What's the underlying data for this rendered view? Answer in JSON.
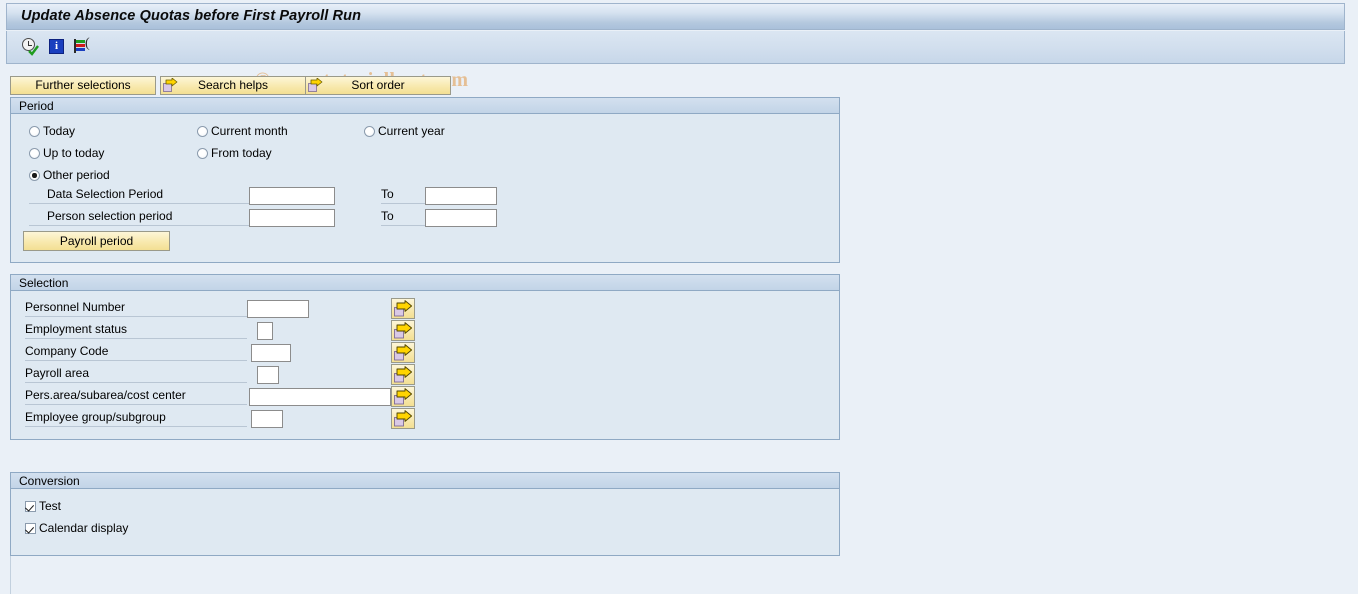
{
  "window": {
    "title": "Update Absence Quotas before First Payroll Run"
  },
  "watermark": "© www.tutorialkart.com",
  "toolbar": {
    "icons": [
      {
        "name": "execute-clock-icon",
        "label": "Execute"
      },
      {
        "name": "information-icon",
        "label": "Information"
      },
      {
        "name": "variants-icon",
        "label": "Variants"
      }
    ]
  },
  "button_row": [
    {
      "label": "Further selections",
      "icon": ""
    },
    {
      "label": "Search helps",
      "icon": "arrow-right-icon"
    },
    {
      "label": "Sort order",
      "icon": "arrow-right-icon"
    }
  ],
  "period": {
    "header": "Period",
    "radios": [
      {
        "label": "Today",
        "selected": false
      },
      {
        "label": "Current month",
        "selected": false
      },
      {
        "label": "Current year",
        "selected": false
      },
      {
        "label": "Up to today",
        "selected": false
      },
      {
        "label": "From today",
        "selected": false
      },
      {
        "label": "Other period",
        "selected": true
      }
    ],
    "fields": [
      {
        "label": "Data Selection Period",
        "value": "",
        "to_label": "To",
        "to_value": ""
      },
      {
        "label": "Person selection period",
        "value": "",
        "to_label": "To",
        "to_value": ""
      }
    ],
    "payroll_period_button": "Payroll period"
  },
  "selection": {
    "header": "Selection",
    "rows": [
      {
        "label": "Personnel Number",
        "value": "",
        "input_width": 62,
        "multi_icon": "multiple-selection-icon"
      },
      {
        "label": "Employment status",
        "value": "",
        "input_width": 16,
        "multi_icon": "multiple-selection-icon"
      },
      {
        "label": "Company Code",
        "value": "",
        "input_width": 36,
        "multi_icon": "multiple-selection-icon"
      },
      {
        "label": "Payroll area",
        "value": "",
        "input_width": 22,
        "multi_icon": "multiple-selection-icon"
      },
      {
        "label": "Pers.area/subarea/cost center",
        "value": "",
        "input_width": 142,
        "multi_icon": "multiple-selection-icon"
      },
      {
        "label": "Employee group/subgroup",
        "value": "",
        "input_width": 30,
        "multi_icon": "multiple-selection-icon"
      }
    ]
  },
  "conversion": {
    "header": "Conversion",
    "checkboxes": [
      {
        "label": "Test",
        "checked": true
      },
      {
        "label": "Calendar display",
        "checked": true
      }
    ]
  },
  "colors": {
    "title_bar": "#b4c8de",
    "panel_bg": "#dfe9f2",
    "panel_border": "#8fa9c4",
    "button_yellow": "#f8e9ae",
    "watermark": "#e5bf95",
    "screen_bg": "#eaf0f7"
  }
}
